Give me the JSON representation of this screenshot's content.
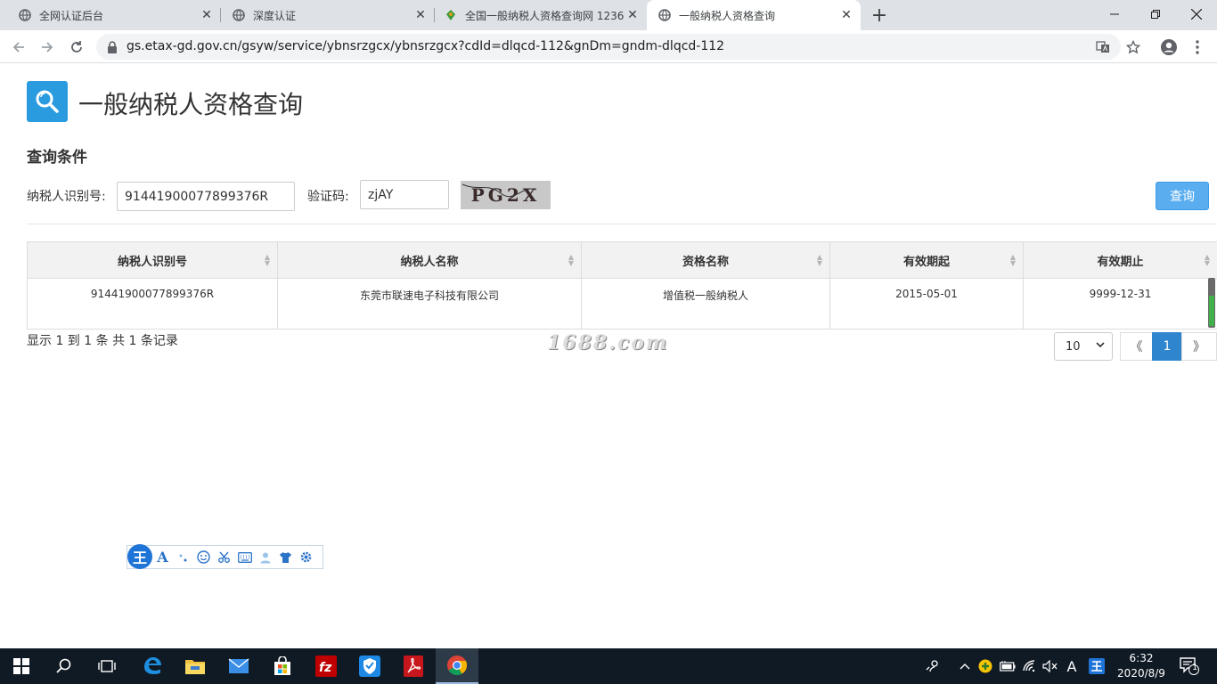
{
  "browser": {
    "tabs": [
      {
        "title": "全网认证后台",
        "active": false
      },
      {
        "title": "深度认证",
        "active": false
      },
      {
        "title": "全国一般纳税人资格查询网 1236",
        "active": false
      },
      {
        "title": "一般纳税人资格查询",
        "active": true
      }
    ],
    "url": "gs.etax-gd.gov.cn/gsyw/service/ybnsrzgcx/ybnsrzgcx?cdId=dlqcd-112&gnDm=gndm-dlqcd-112"
  },
  "page": {
    "title": "一般纳税人资格查询",
    "section_title": "查询条件",
    "taxpayer_id_label": "纳税人识别号:",
    "taxpayer_id_value": "91441900077899376R",
    "captcha_label": "验证码:",
    "captcha_value": "zjAY",
    "captcha_image_text": "PG2X",
    "query_button": "查询"
  },
  "table": {
    "headers": [
      "纳税人识别号",
      "纳税人名称",
      "资格名称",
      "有效期起",
      "有效期止"
    ],
    "rows": [
      [
        "91441900077899376R",
        "东莞市联速电子科技有限公司",
        "增值税一般纳税人",
        "2015-05-01",
        "9999-12-31"
      ]
    ]
  },
  "pagination": {
    "record_info": "显示 1 到 1 条 共 1 条记录",
    "page_size": "10",
    "prev": "《",
    "current": "1",
    "next": "》"
  },
  "watermark": "1688.com",
  "ime": {
    "logo": "王",
    "font_tool": "A"
  },
  "taskbar": {
    "time": "6:32",
    "date": "2020/8/9",
    "tray_ime": "A",
    "notification_count": "1"
  },
  "colors": {
    "accent": "#2b9be0",
    "button": "#5aaef0",
    "pager_active": "#2f86cf",
    "taskbar": "#101a24"
  }
}
